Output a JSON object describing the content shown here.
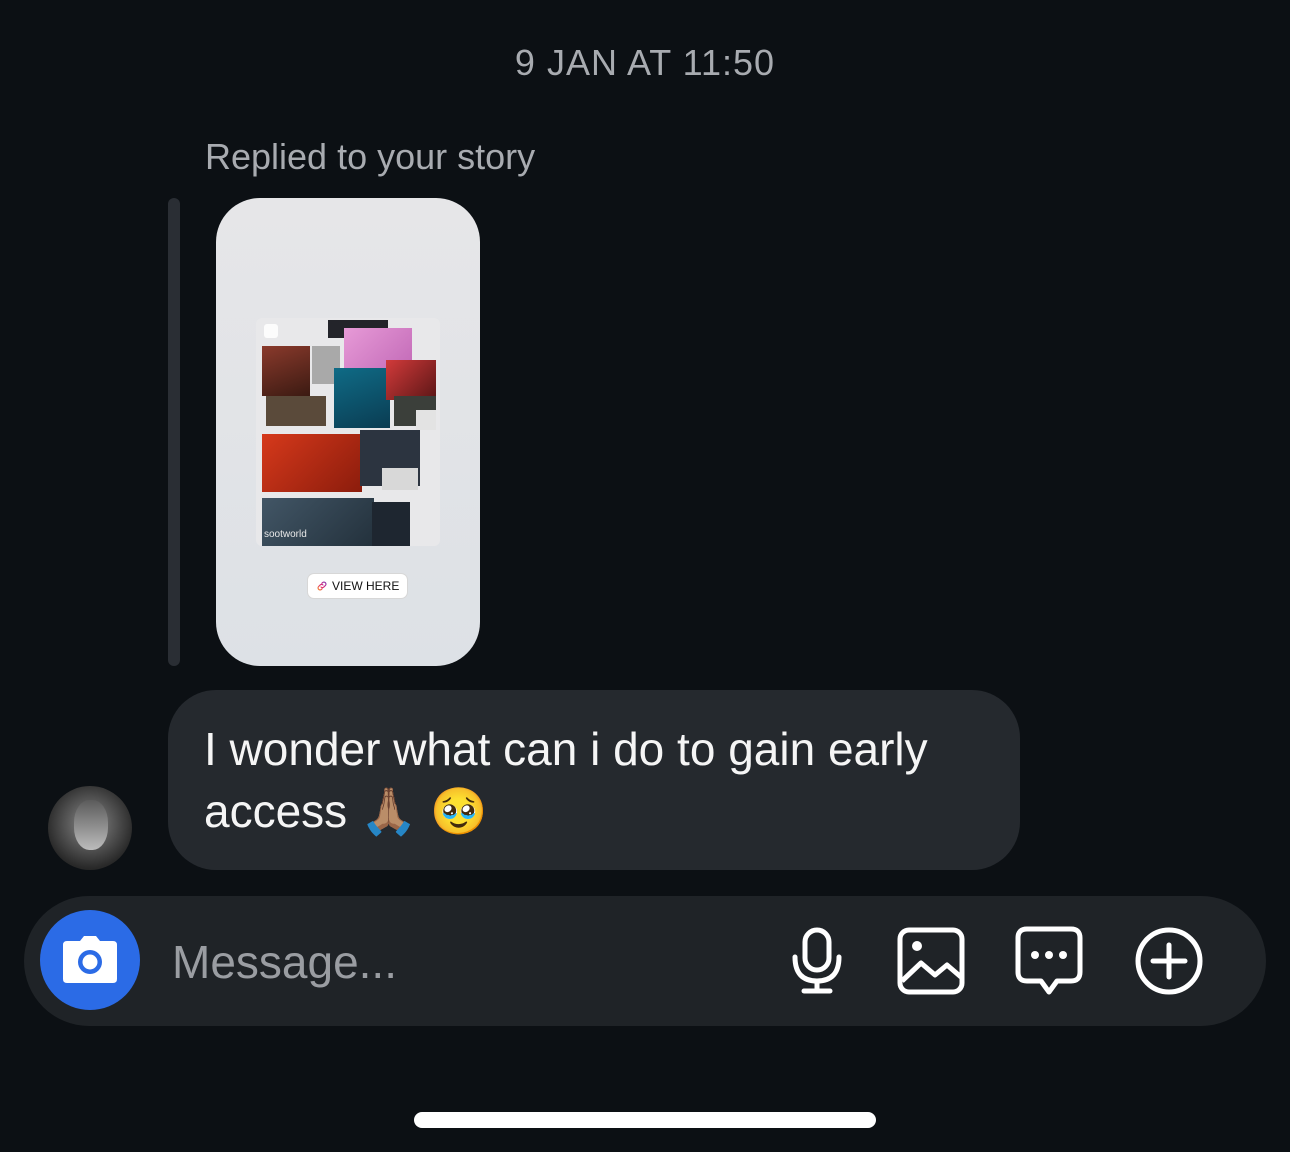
{
  "thread": {
    "timestamp": "9 JAN AT 11:50",
    "reply_label": "Replied to your story"
  },
  "story": {
    "collage_caption": "sootworld",
    "link_label": "VIEW HERE"
  },
  "message": {
    "text": "I wonder what can i do to gain early access 🙏🏽 🥹"
  },
  "composer": {
    "placeholder": "Message...",
    "icons": [
      "camera-icon",
      "microphone-icon",
      "gallery-icon",
      "sticker-icon",
      "plus-icon"
    ],
    "camera_color": "#2b6be6"
  },
  "colors": {
    "background": "#0c1014",
    "bubble": "#25292e",
    "muted_text": "#a8abb0"
  }
}
